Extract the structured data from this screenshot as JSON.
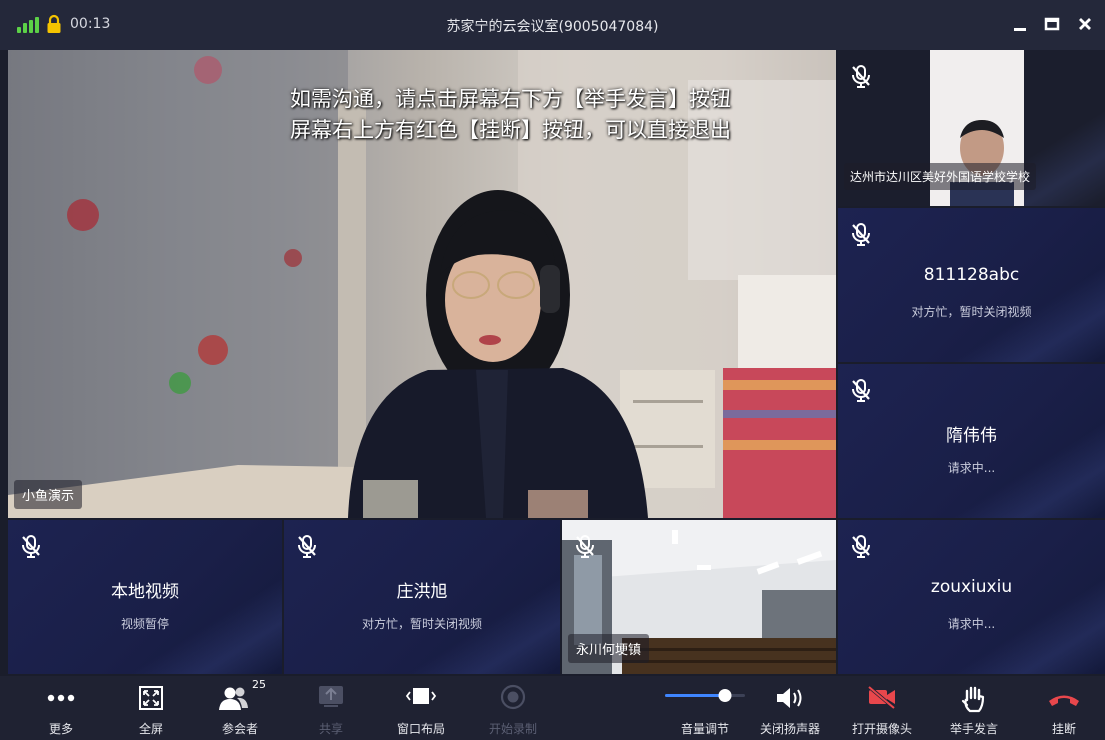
{
  "titlebar": {
    "timer": "00:13",
    "title": "苏家宁的云会议室(9005047084)"
  },
  "main_video": {
    "subtitle_line1": "如需沟通，请点击屏幕右下方【举手发言】按钮",
    "subtitle_line2": "屏幕右上方有红色【挂断】按钮，可以直接退出",
    "name_tag": "小鱼演示"
  },
  "side_tiles": [
    {
      "name_tag": "达州市达川区美好外国语学校学校"
    },
    {
      "name": "811128abc",
      "status": "对方忙，暂时关闭视频"
    },
    {
      "name": "隋伟伟",
      "status": "请求中..."
    },
    {
      "name": "zouxiuxiu",
      "status": "请求中..."
    }
  ],
  "bottom_tiles": [
    {
      "name": "本地视频",
      "status": "视频暂停"
    },
    {
      "name": "庄洪旭",
      "status": "对方忙，暂时关闭视频"
    },
    {
      "name_tag": "永川何埂镇"
    }
  ],
  "toolbar": {
    "more": "更多",
    "fullscreen": "全屏",
    "participants": "参会者",
    "participant_count": "25",
    "share": "共享",
    "layout": "窗口布局",
    "record": "开始录制",
    "volume": "音量调节",
    "volume_level": 0.75,
    "speaker": "关闭扬声器",
    "camera": "打开摄像头",
    "raise_hand": "举手发言",
    "hangup": "挂断"
  },
  "colors": {
    "signal": "#5cd147",
    "lock": "#f5c400",
    "accent": "#3f86ff",
    "danger": "#e8474c",
    "tile_bg": "#1d2351",
    "toolbar_bg": "#1f2232"
  }
}
